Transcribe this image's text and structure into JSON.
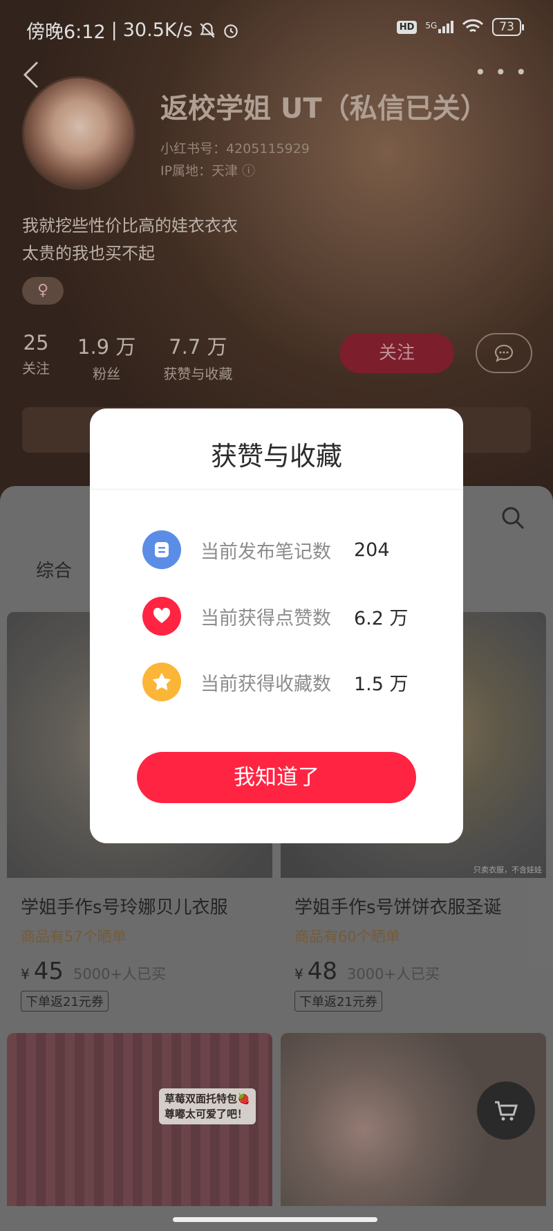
{
  "status_bar": {
    "time": "傍晚6:12",
    "net_speed": "30.5K/s",
    "hd": "HD",
    "signal": "5G",
    "battery": "73"
  },
  "profile": {
    "nickname": "返校学姐 UT（私信已关）",
    "xhs_id": "小红书号：4205115929",
    "ip_location": "IP属地：天津 ⓘ",
    "bio_line1": "我就挖些性价比高的娃衣衣衣",
    "bio_line2": "太贵的我也买不起",
    "gender": "♀",
    "stats": [
      {
        "num": "25",
        "label": "关注"
      },
      {
        "num": "1.9 万",
        "label": "粉丝"
      },
      {
        "num": "7.7 万",
        "label": "获赞与收藏"
      }
    ],
    "follow_label": "关注",
    "message_icon": "chat-bubble-icon"
  },
  "content": {
    "active_tab": "综合",
    "products": [
      {
        "title": "学姐手作s号玲娜贝儿衣服",
        "sold_note": "商品有57个晒单",
        "currency": "¥",
        "price": "45",
        "buyers": "5000+人已买",
        "coupon": "下单返21元券"
      },
      {
        "title": "学姐手作s号饼饼衣服圣诞",
        "sold_note": "商品有60个晒单",
        "currency": "¥",
        "price": "48",
        "buyers": "3000+人已买",
        "coupon": "下单返21元券"
      }
    ],
    "photo_caption": "只卖衣服，不含娃娃",
    "sticker_line1": "草莓双面托特包🍓",
    "sticker_line2": "尊嘟太可爱了吧！"
  },
  "dialog": {
    "title": "获赞与收藏",
    "rows": [
      {
        "icon": "note-icon",
        "label": "当前发布笔记数",
        "value": "204",
        "color": "#5b8de6"
      },
      {
        "icon": "heart-icon",
        "label": "当前获得点赞数",
        "value": "6.2 万",
        "color": "#ff2442"
      },
      {
        "icon": "star-icon",
        "label": "当前获得收藏数",
        "value": "1.5 万",
        "color": "#fbb637"
      }
    ],
    "button_label": "我知道了"
  }
}
